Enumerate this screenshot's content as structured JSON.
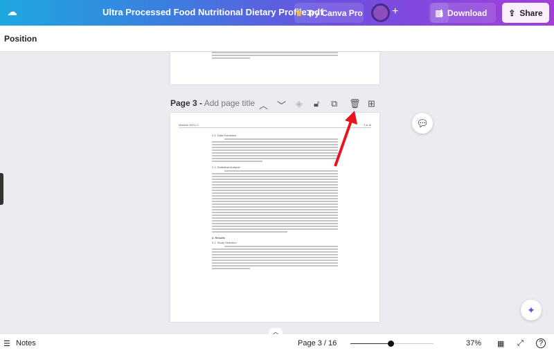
{
  "header": {
    "title": "Ultra Processed Food Nutritional Dietary Profile.pdf",
    "try_pro": "Try Canva Pro",
    "plus": "+",
    "download": "Download",
    "share": "Share"
  },
  "toolbar": {
    "position": "Position"
  },
  "page": {
    "label": "Page 3 -",
    "title_placeholder": "Add page title",
    "doc_header_left": "Nutrients 2023,1,0",
    "doc_header_right": "3 of 16",
    "headings": [
      "2.2. Data Extraction",
      "2.3. Statistical Analysis",
      "3. Results",
      "3.1. Study Selection"
    ]
  },
  "footer": {
    "notes": "Notes",
    "page_indicator": "Page 3 / 16",
    "zoom": "37%",
    "zoom_value": 37
  },
  "colors": {
    "accent": "#7d2ae8",
    "arrow": "#e8141b"
  }
}
